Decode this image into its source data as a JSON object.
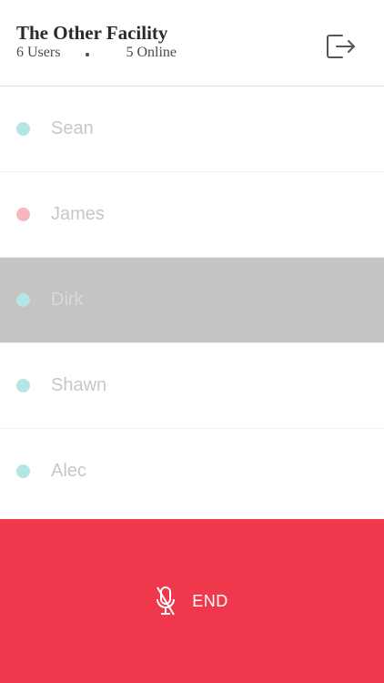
{
  "header": {
    "title": "The Other Facility",
    "users_count": "6 Users",
    "online_count": "5 Online",
    "logout_icon": "logout-icon"
  },
  "status": {
    "battery_color": "#22c55e"
  },
  "users": [
    {
      "name": "Sean",
      "status_color": "#b3e6e4",
      "selected": false
    },
    {
      "name": "James",
      "status_color": "#f5b8bf",
      "selected": false
    },
    {
      "name": "Dirk",
      "status_color": "#b3e6e4",
      "selected": true
    },
    {
      "name": "Shawn",
      "status_color": "#b3e6e4",
      "selected": false
    },
    {
      "name": "Alec",
      "status_color": "#b3e6e4",
      "selected": false
    }
  ],
  "footer": {
    "end_label": "END",
    "mic_icon": "mic-off-icon",
    "background": "#f0384c"
  }
}
